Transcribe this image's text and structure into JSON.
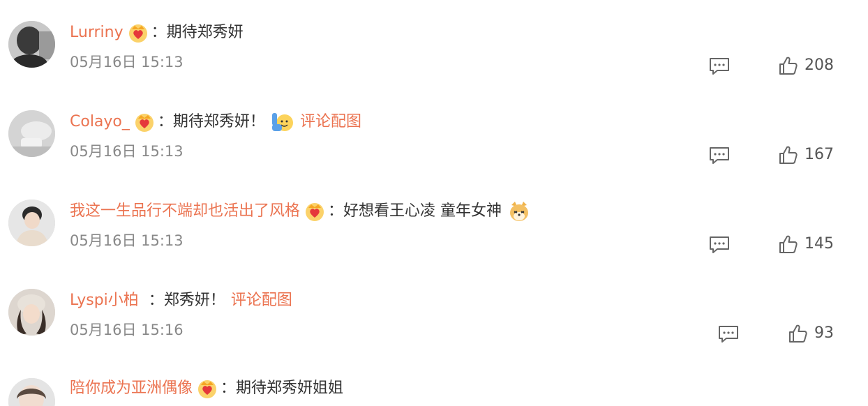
{
  "comments": [
    {
      "username": "Lurriny",
      "has_badge": true,
      "separator": "：",
      "text": "期待郑秀妍",
      "emoji": "",
      "image_link": "",
      "timestamp": "05月16日 15:13",
      "likes": "208"
    },
    {
      "username": "Colayo_",
      "has_badge": true,
      "separator": "：",
      "text": "期待郑秀妍！",
      "emoji": "raised-hand-smile-emoji",
      "image_link": "评论配图",
      "timestamp": "05月16日 15:13",
      "likes": "167"
    },
    {
      "username": "我这一生品行不端却也活出了风格",
      "has_badge": true,
      "separator": "：",
      "text": "好想看王心凌 童年女神",
      "emoji": "shiba-dog-emoji",
      "image_link": "",
      "timestamp": "05月16日 15:13",
      "likes": "145"
    },
    {
      "username": "Lyspi小柏",
      "has_badge": false,
      "separator": "：",
      "text": "郑秀妍！",
      "emoji": "",
      "image_link": "评论配图",
      "timestamp": "05月16日 15:16",
      "likes": "93"
    },
    {
      "username": "陪你成为亚洲偶像",
      "has_badge": true,
      "separator": "：",
      "text": "期待郑秀妍姐姐",
      "emoji": "",
      "image_link": "",
      "timestamp": "",
      "likes": ""
    }
  ],
  "icons": {
    "badge": "vip-crown-heart-icon",
    "reply": "comment-reply-icon",
    "like": "thumbs-up-icon"
  },
  "colors": {
    "username": "#eb7350",
    "text": "#333333",
    "meta": "#888888",
    "badge": "#f5a623"
  }
}
